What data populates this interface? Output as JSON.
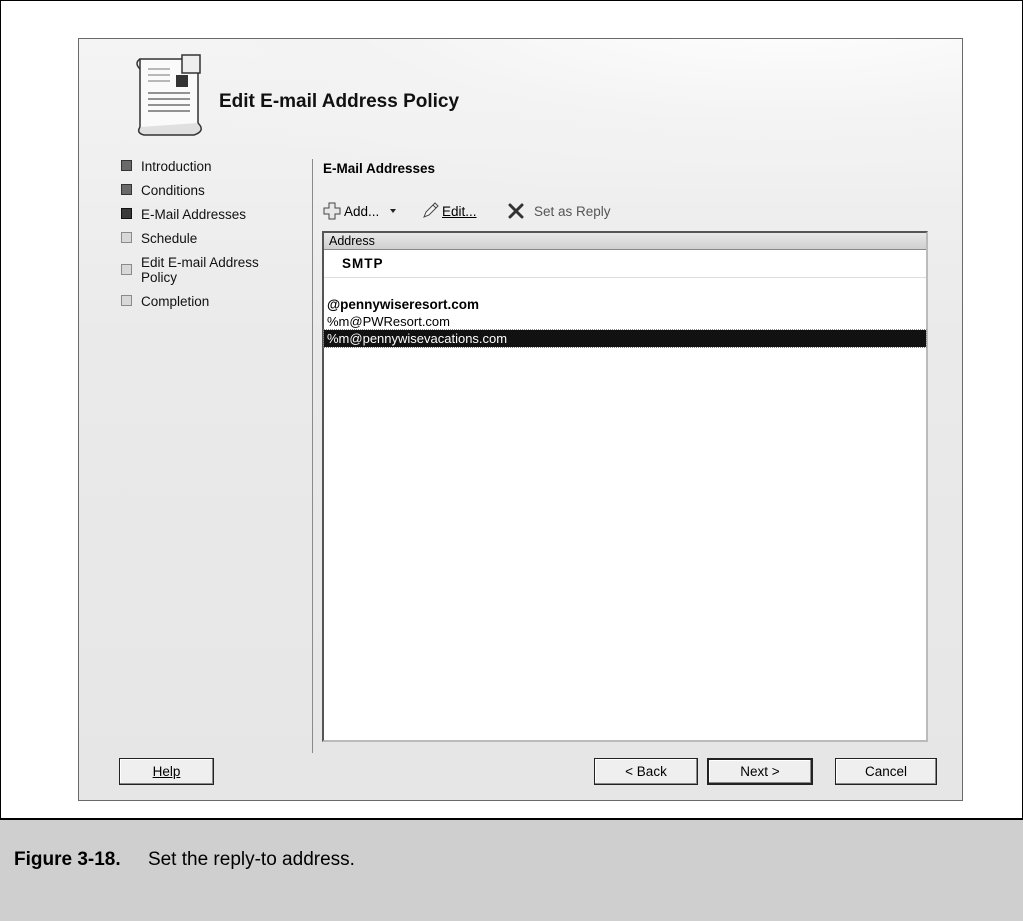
{
  "dialog": {
    "title": "Edit E-mail Address Policy",
    "nav": [
      {
        "label": "Introduction",
        "state": "done"
      },
      {
        "label": "Conditions",
        "state": "done"
      },
      {
        "label": "E-Mail Addresses",
        "state": "current"
      },
      {
        "label": "Schedule",
        "state": "pending"
      },
      {
        "label": "Edit E-mail Address Policy",
        "state": "pending"
      },
      {
        "label": "Completion",
        "state": "pending"
      }
    ],
    "section_title": "E-Mail Addresses",
    "toolbar": {
      "add": {
        "label": "Add...",
        "icon": "add-icon"
      },
      "edit": {
        "label": "Edit...",
        "icon": "pencil-icon"
      },
      "set_reply": {
        "label": "Set as Reply",
        "icon": "delete-x-icon"
      }
    },
    "list": {
      "column_header": "Address",
      "group": "SMTP",
      "rows": [
        {
          "text": "@pennywiseresort.com",
          "bold": true,
          "selected": false
        },
        {
          "text": "%m@PWResort.com",
          "bold": false,
          "selected": false
        },
        {
          "text": "%m@pennywisevacations.com",
          "bold": false,
          "selected": true
        }
      ]
    },
    "buttons": {
      "help": "Help",
      "back": "< Back",
      "next": "Next >",
      "cancel": "Cancel"
    }
  },
  "caption": {
    "number": "Figure 3-18.",
    "text": "Set the reply-to address."
  }
}
